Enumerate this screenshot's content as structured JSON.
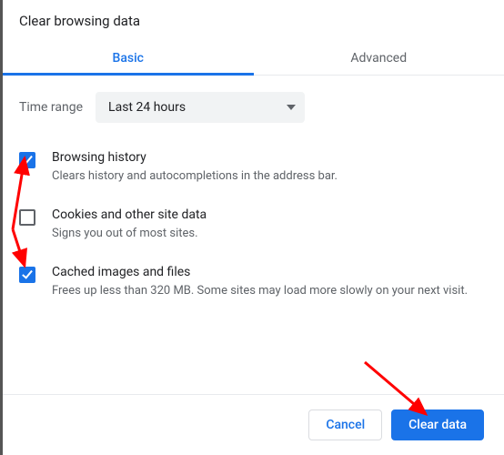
{
  "dialog": {
    "title": "Clear browsing data"
  },
  "tabs": {
    "basic": "Basic",
    "advanced": "Advanced",
    "active": "basic"
  },
  "time_range": {
    "label": "Time range",
    "value": "Last 24 hours"
  },
  "options": [
    {
      "key": "browsing-history",
      "checked": true,
      "title": "Browsing history",
      "desc": "Clears history and autocompletions in the address bar."
    },
    {
      "key": "cookies",
      "checked": false,
      "title": "Cookies and other site data",
      "desc": "Signs you out of most sites."
    },
    {
      "key": "cache",
      "checked": true,
      "title": "Cached images and files",
      "desc": "Frees up less than 320 MB. Some sites may load more slowly on your next visit."
    }
  ],
  "footer": {
    "cancel": "Cancel",
    "clear": "Clear data"
  },
  "annotations": {
    "arrow_color": "#ff0000",
    "arrows": [
      {
        "from": "checkbox-browsing-history",
        "to_region": "below-left"
      },
      {
        "from": "checkbox-cache",
        "to_region": "above"
      },
      {
        "from": "button-clear-data",
        "to_region": "upper-left"
      }
    ]
  }
}
